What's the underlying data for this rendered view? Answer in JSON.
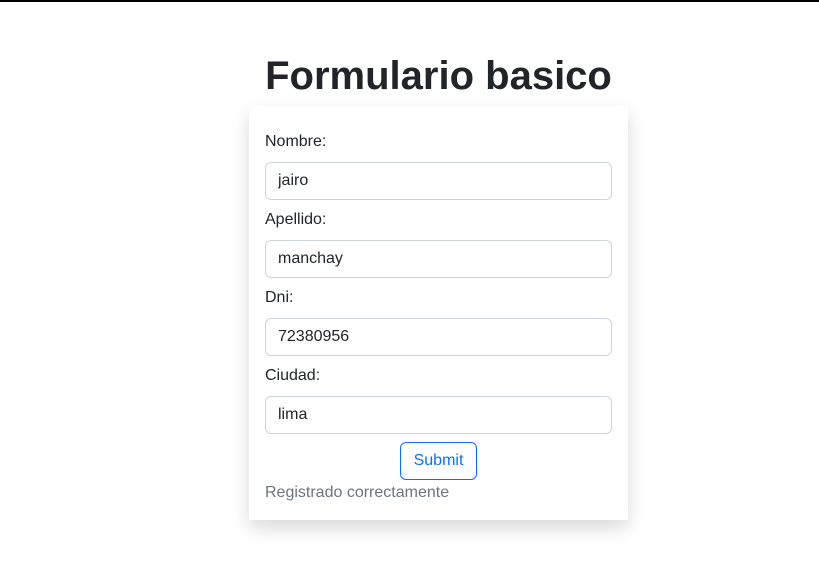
{
  "page": {
    "title": "Formulario basico"
  },
  "form": {
    "fields": [
      {
        "label": "Nombre:",
        "value": "jairo"
      },
      {
        "label": "Apellido:",
        "value": "manchay"
      },
      {
        "label": "Dni:",
        "value": "72380956"
      },
      {
        "label": "Ciudad:",
        "value": "lima"
      }
    ],
    "submit_label": "Submit",
    "status_message": "Registrado correctamente"
  },
  "colors": {
    "accent": "#0d6efd",
    "text": "#212529",
    "muted": "#6c757d",
    "input_border": "#ced4da"
  }
}
